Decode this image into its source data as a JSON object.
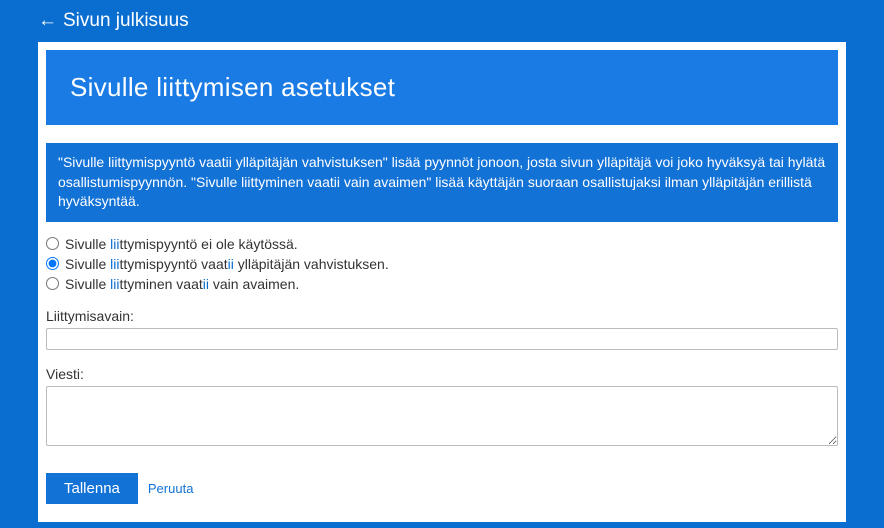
{
  "back": {
    "arrow": "←",
    "label": "Sivun julkisuus"
  },
  "title": "Sivulle liittymisen asetukset",
  "info_text": "\"Sivulle liittymispyyntö vaatii ylläpitäjän vahvistuksen\" lisää pyynnöt jonoon, josta sivun ylläpitäjä voi joko hyväksyä tai hylätä osallistumispyynnön. \"Sivulle liittyminen vaatii vain avaimen\" lisää käyttäjän suoraan osallistujaksi ilman ylläpitäjän erillistä hyväksyntää.",
  "radios": {
    "option1": {
      "prefix": "Sivulle ",
      "hl": "lii",
      "suffix": "ttymispyyntö ei ole käytössä."
    },
    "option2": {
      "prefix": "Sivulle ",
      "hl1": "lii",
      "mid": "ttymispyyntö vaat",
      "hl2": "ii",
      "suffix": " ylläpitäjän vahvistuksen."
    },
    "option3": {
      "prefix": "Sivulle ",
      "hl1": "lii",
      "mid": "ttyminen vaat",
      "hl2": "ii",
      "suffix": " vain avaimen."
    },
    "selected": 1
  },
  "join_key": {
    "label": "Liittymisavain:",
    "value": ""
  },
  "message": {
    "label": "Viesti:",
    "value": ""
  },
  "buttons": {
    "save": "Tallenna",
    "cancel": "Peruuta"
  }
}
